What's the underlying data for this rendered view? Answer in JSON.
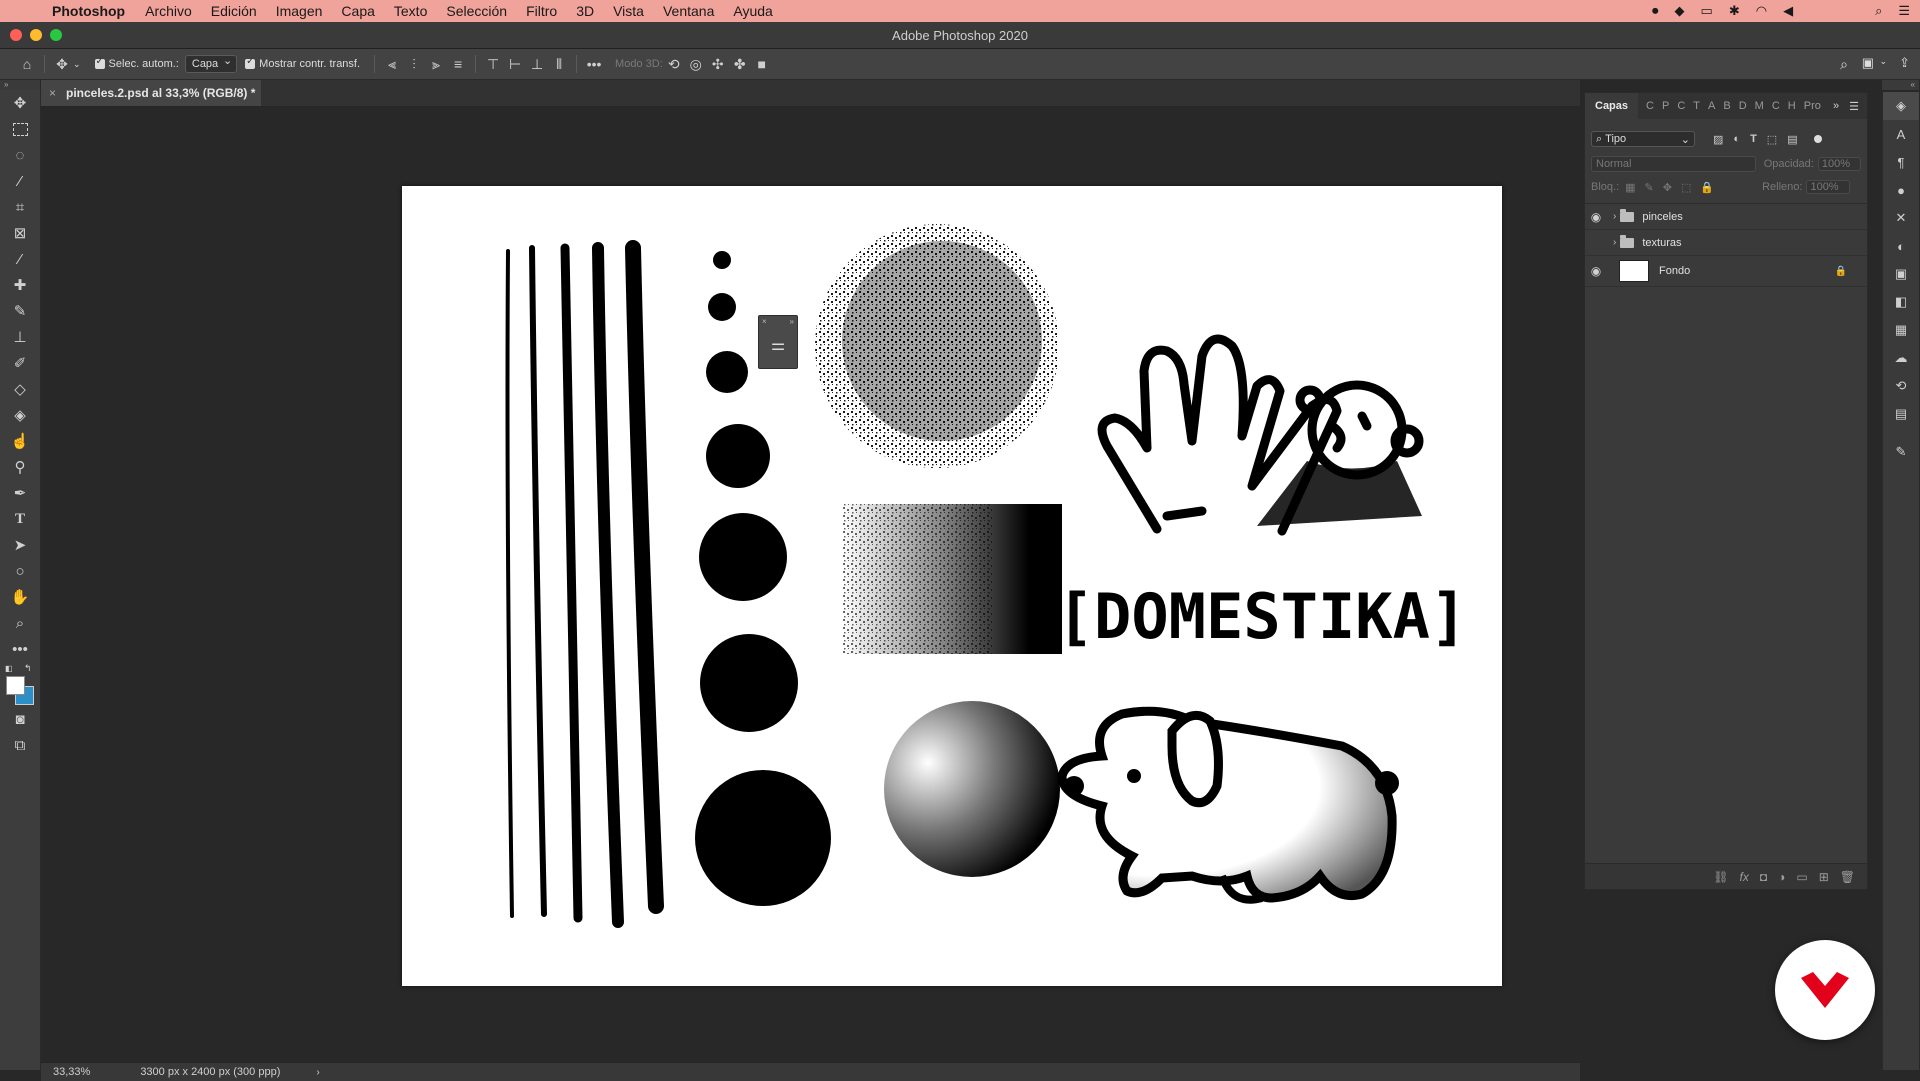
{
  "menubar": {
    "app_name": "Photoshop",
    "items": [
      "Archivo",
      "Edición",
      "Imagen",
      "Capa",
      "Texto",
      "Selección",
      "Filtro",
      "3D",
      "Vista",
      "Ventana",
      "Ayuda"
    ]
  },
  "window": {
    "title": "Adobe Photoshop 2020"
  },
  "options": {
    "auto_select_label": "Selec. autom.:",
    "auto_select_value": "Capa",
    "show_transform_label": "Mostrar contr. transf.",
    "mode_3d_label": "Modo 3D:"
  },
  "document": {
    "tab_title": "pinceles.2.psd al 33,3% (RGB/8) *"
  },
  "status": {
    "zoom": "33,33%",
    "doc_info": "3300 px x 2400 px (300 ppp)"
  },
  "layers_panel": {
    "active_tab": "Capas",
    "other_tabs": [
      "C",
      "P",
      "C",
      "T",
      "A",
      "B",
      "D",
      "M",
      "C",
      "H",
      "Pro"
    ],
    "filter_label": "Tipo",
    "blend_mode": "Normal",
    "opacity_label": "Opacidad:",
    "opacity_value": "100%",
    "lock_label": "Bloq.:",
    "fill_label": "Relleno:",
    "fill_value": "100%",
    "layers": [
      {
        "name": "pinceles",
        "type": "group",
        "visible": true
      },
      {
        "name": "texturas",
        "type": "group",
        "visible": false
      },
      {
        "name": "Fondo",
        "type": "background",
        "visible": true,
        "locked": true
      }
    ]
  },
  "canvas": {
    "lettering": "[DOMESTIKA]"
  },
  "colors": {
    "menubar_bg": "#f0a39a",
    "logo_red": "#e3001b",
    "foreground": "#ffffff",
    "background": "#2d8fc7"
  }
}
